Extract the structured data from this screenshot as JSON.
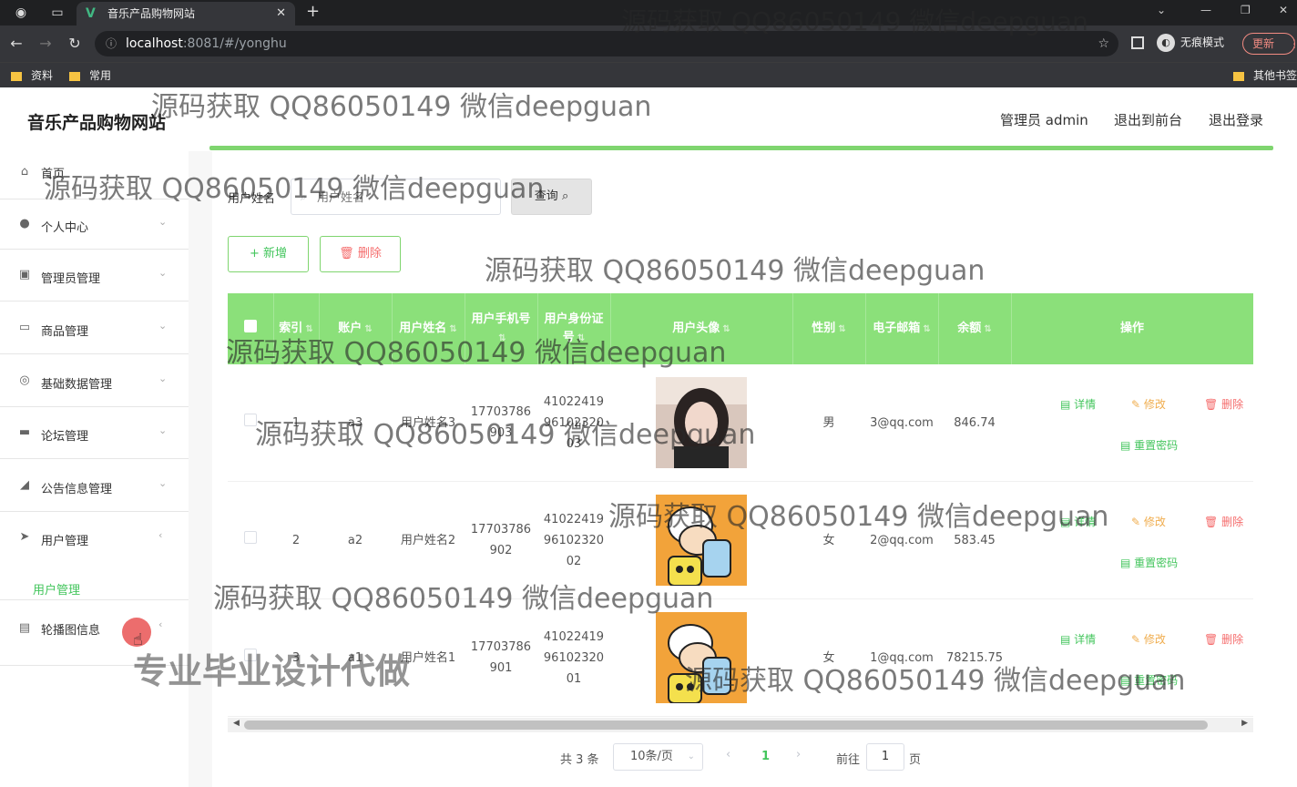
{
  "browser": {
    "tab_title": "音乐产品购物网站",
    "tab_logo": "V",
    "url_host": "localhost",
    "url_rest": ":8081/#/yonghu",
    "incognito_label": "无痕模式",
    "update_label": "更新",
    "bookmarks": [
      "资料",
      "常用"
    ],
    "other_bookmarks": "其他书签"
  },
  "header": {
    "title": "音乐产品购物网站",
    "admin_label": "管理员 admin",
    "front_label": "退出到前台",
    "logout_label": "退出登录"
  },
  "sidebar": {
    "items": [
      {
        "label": "首页",
        "icon": "home-icon",
        "glyph": "⌂"
      },
      {
        "label": "个人中心",
        "icon": "user-icon",
        "glyph": "●"
      },
      {
        "label": "管理员管理",
        "icon": "admin-icon",
        "glyph": "▣"
      },
      {
        "label": "商品管理",
        "icon": "message-icon",
        "glyph": "▭"
      },
      {
        "label": "基础数据管理",
        "icon": "compass-icon",
        "glyph": "◎"
      },
      {
        "label": "论坛管理",
        "icon": "suitcase-icon",
        "glyph": "▬"
      },
      {
        "label": "公告信息管理",
        "icon": "megaphone-icon",
        "glyph": "◢"
      },
      {
        "label": "用户管理",
        "icon": "send-icon",
        "glyph": "➤"
      },
      {
        "label": "轮播图信息",
        "icon": "document-icon",
        "glyph": "▤"
      }
    ],
    "active_sub": "用户管理"
  },
  "search": {
    "label": "用户姓名",
    "placeholder": "用户姓名",
    "button": "查询"
  },
  "actions": {
    "add": "+ 新增",
    "delete": "删除"
  },
  "table": {
    "headers": [
      "索引",
      "账户",
      "用户姓名",
      "用户手机号",
      "用户身份证号",
      "用户头像",
      "性别",
      "电子邮箱",
      "余额",
      "操作"
    ],
    "rows": [
      {
        "index": "1",
        "account": "a3",
        "name": "用户姓名3",
        "phone": "17703786903",
        "idcard": "410224199610232003",
        "gender": "男",
        "email": "3@qq.com",
        "balance": "846.74",
        "avatar": "photo"
      },
      {
        "index": "2",
        "account": "a2",
        "name": "用户姓名2",
        "phone": "17703786902",
        "idcard": "410224199610232002",
        "gender": "女",
        "email": "2@qq.com",
        "balance": "583.45",
        "avatar": "cartoon"
      },
      {
        "index": "3",
        "account": "a1",
        "name": "用户姓名1",
        "phone": "17703786901",
        "idcard": "410224199610232001",
        "gender": "女",
        "email": "1@qq.com",
        "balance": "78215.75",
        "avatar": "cartoon"
      }
    ],
    "row_actions": {
      "detail": "详情",
      "edit": "修改",
      "delete": "删除",
      "reset": "重置密码"
    }
  },
  "pagination": {
    "total": "共 3 条",
    "page_size": "10条/页",
    "current_page": "1",
    "goto_label": "前往",
    "goto_value": "1",
    "page_suffix": "页"
  },
  "watermarks": {
    "text": "源码获取 QQ86050149 微信deepguan",
    "big": "专业毕业设计代做"
  },
  "colors": {
    "accent": "#8be07a",
    "accent_text": "#43c55c",
    "danger": "#f56c6c",
    "warning": "#f0ad4e"
  }
}
